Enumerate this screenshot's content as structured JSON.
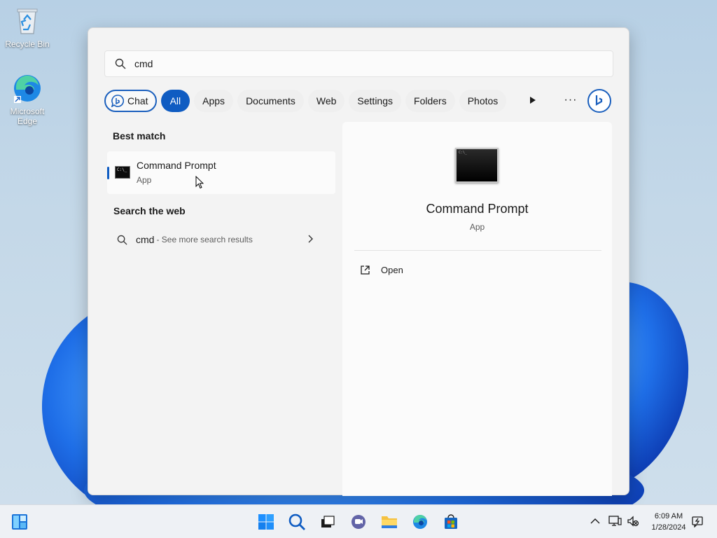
{
  "desktop": {
    "icons": [
      {
        "label": "Recycle Bin"
      },
      {
        "label": "Microsoft Edge"
      }
    ]
  },
  "search": {
    "query": "cmd"
  },
  "filters": {
    "chat": "Chat",
    "all": "All",
    "apps": "Apps",
    "documents": "Documents",
    "web": "Web",
    "settings": "Settings",
    "folders": "Folders",
    "photos": "Photos",
    "more": "···"
  },
  "results": {
    "best_match_title": "Best match",
    "best_match": {
      "name": "Command Prompt",
      "type": "App"
    },
    "web_title": "Search the web",
    "web_item": {
      "query": "cmd",
      "suffix": "- See more search results"
    }
  },
  "detail": {
    "title": "Command Prompt",
    "subtitle": "App",
    "actions": [
      {
        "label": "Open"
      }
    ]
  },
  "taskbar": {
    "time": "6:09 AM",
    "date": "1/28/2024"
  },
  "colors": {
    "accent": "#0f5cc2",
    "bing_blue": "#1a5fbd"
  }
}
